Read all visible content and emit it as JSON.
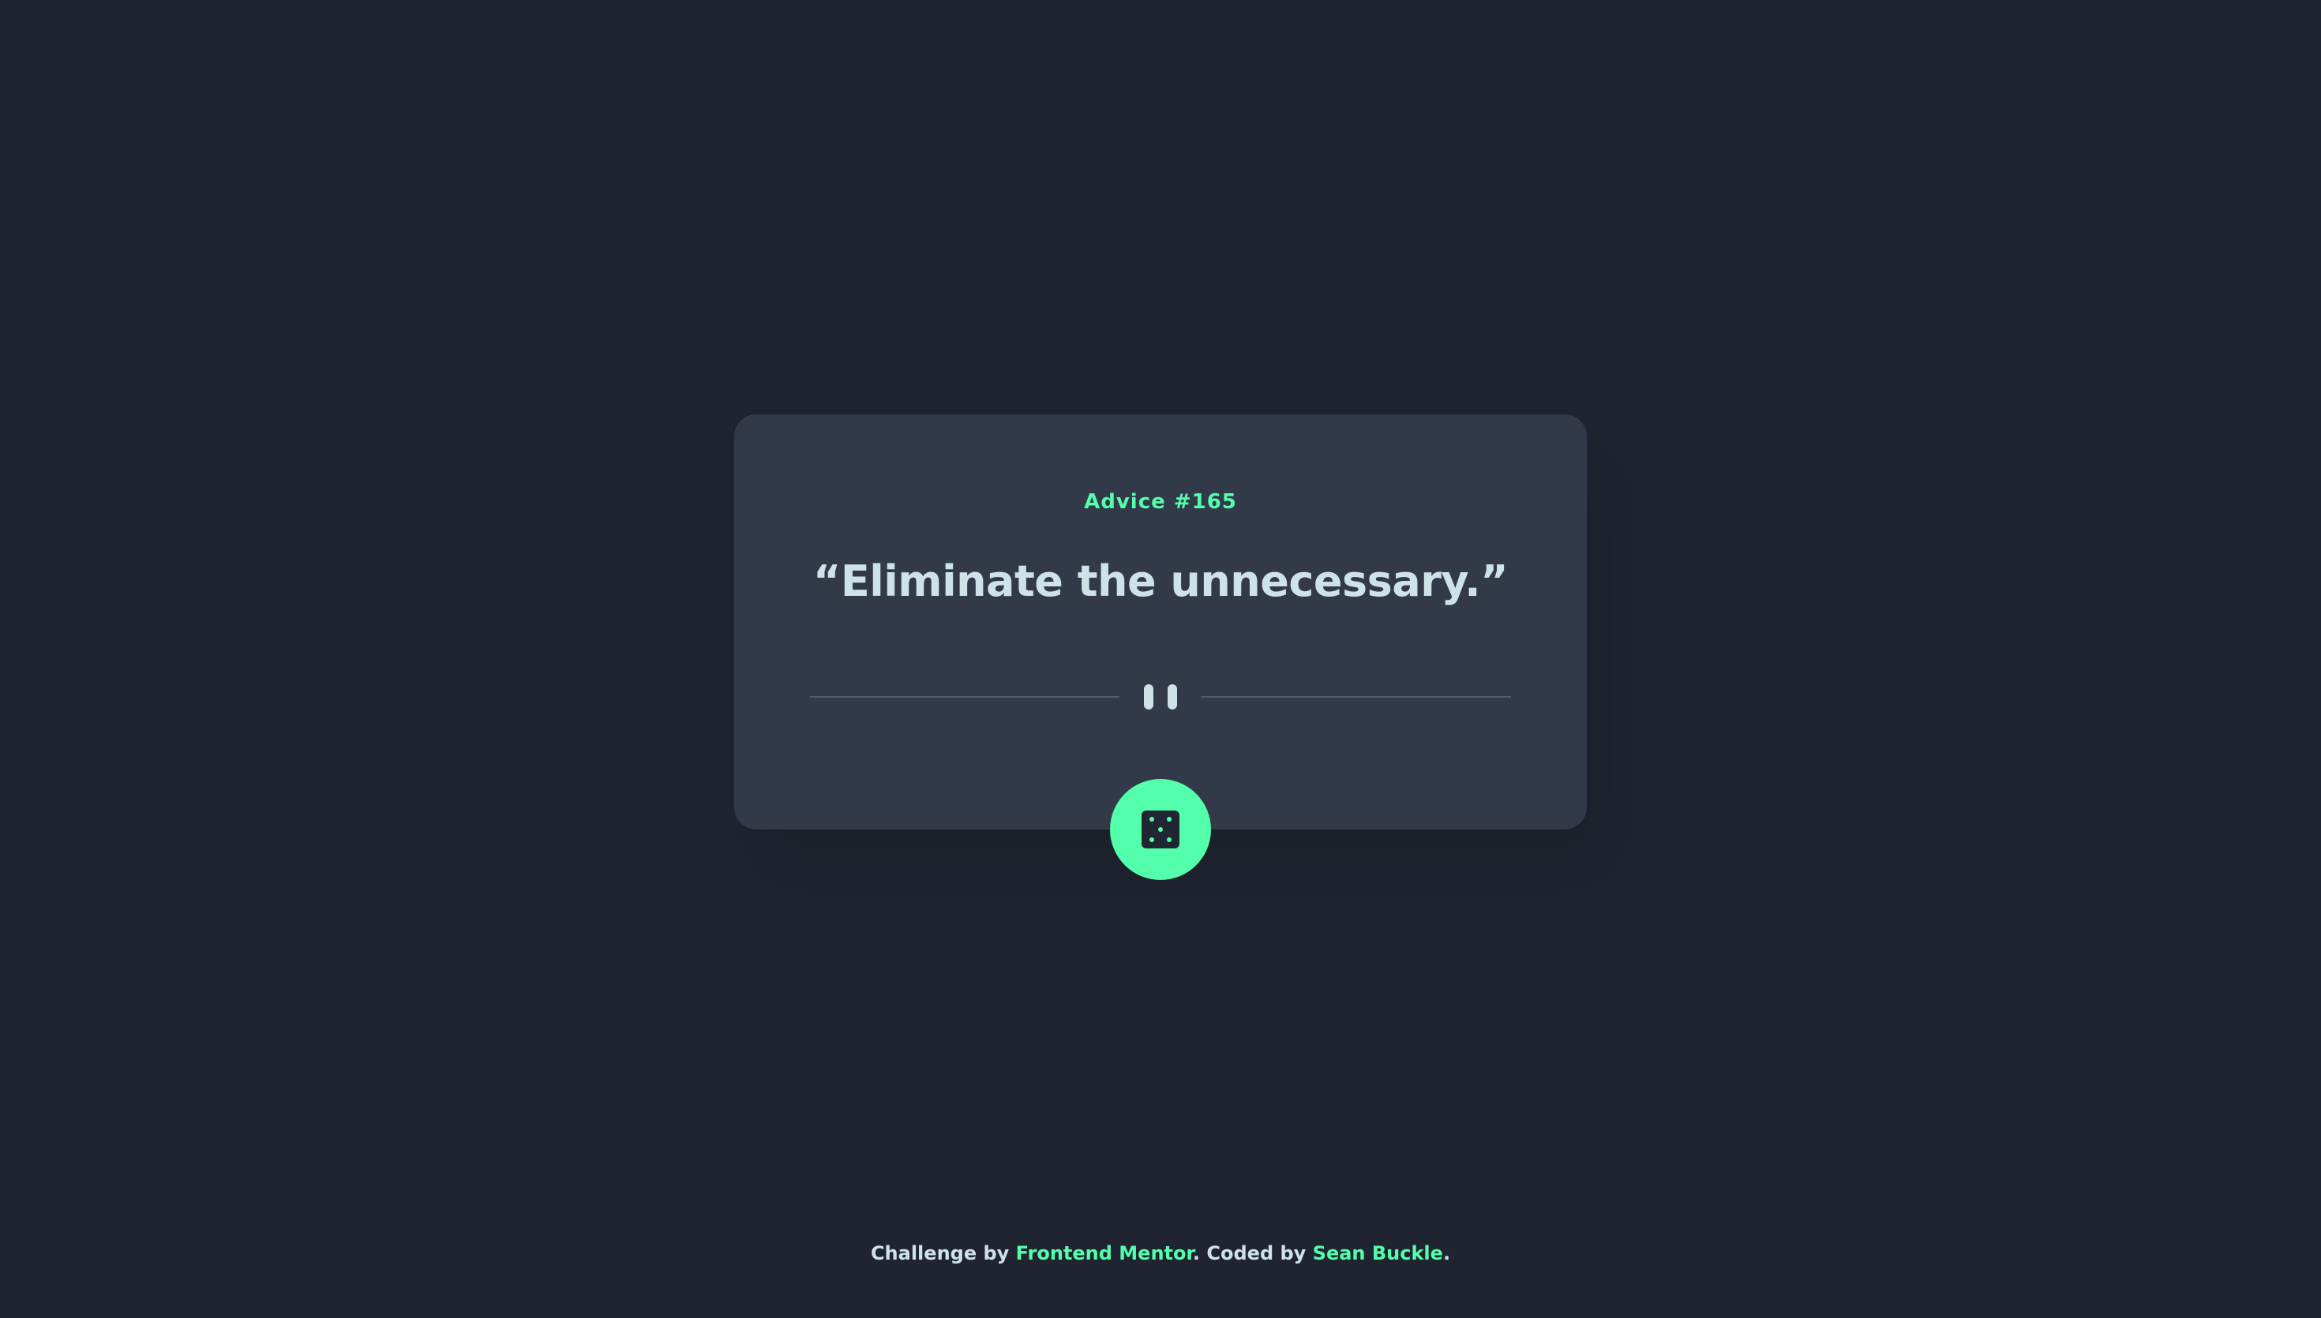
{
  "advice": {
    "label": "Advice #165",
    "quote": "“Eliminate the unnecessary.”"
  },
  "divider": {
    "icon": "pause-icon"
  },
  "dice_button": {
    "icon": "dice-icon"
  },
  "footer": {
    "prefix": "Challenge by ",
    "challenge_link": "Frontend Mentor",
    "middle": ". Coded by ",
    "author_link": "Sean Buckle",
    "suffix": "."
  },
  "colors": {
    "background": "#1f2430",
    "card": "#323a49",
    "accent": "#53ffaa",
    "text": "#cee3e9",
    "divider": "#4f5d74"
  }
}
